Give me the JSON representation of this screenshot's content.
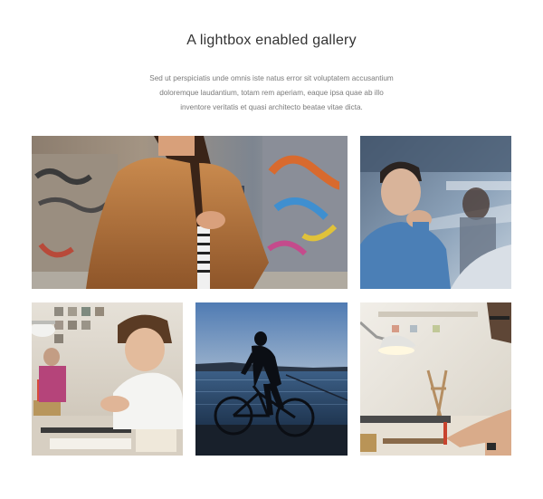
{
  "header": {
    "title": "A lightbox enabled gallery",
    "description_lines": [
      "Sed ut perspiciatis unde omnis iste natus error sit voluptatem accusantium",
      "doloremque laudantium, totam rem aperiam, eaque ipsa quae ab illo",
      "inventore veritatis et quasi architecto beatae vitae dicta."
    ]
  },
  "gallery": {
    "items": [
      {
        "subject": "woman-brown-leather-jacket-graffiti-wall"
      },
      {
        "subject": "man-thinking-behind-window"
      },
      {
        "subject": "boy-drawing-at-desk"
      },
      {
        "subject": "cyclist-silhouette-at-sunset"
      },
      {
        "subject": "hands-working-under-desk-lamp"
      }
    ]
  },
  "colors": {
    "background": "#ffffff",
    "title": "#333333",
    "body_text": "#7a7a7a"
  }
}
